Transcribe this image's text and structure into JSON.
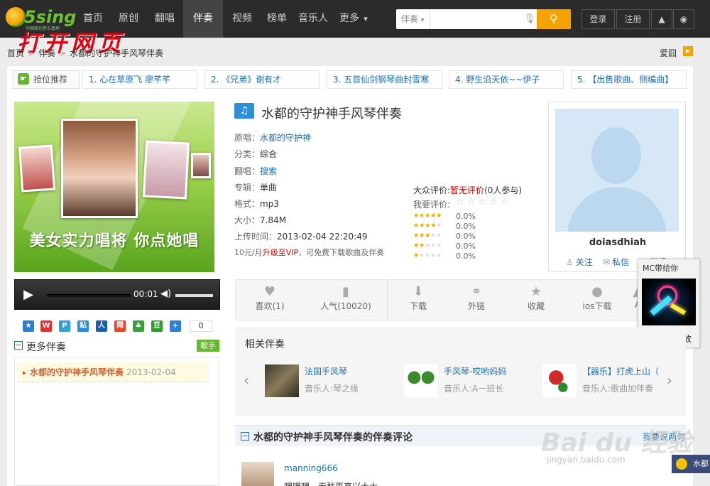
{
  "topnav": {
    "logo_text": "5sing",
    "logo_sub": "中国原创音乐基地",
    "items": [
      "首页",
      "原创",
      "翻唱",
      "伴奏",
      "视频",
      "榜单",
      "音乐人",
      "更多"
    ],
    "active": "伴奏",
    "more_arrow": "▾",
    "search_select": "伴奏",
    "search_select_arrow": "▾",
    "search_placeholder": "",
    "login": "登录",
    "register": "注册"
  },
  "watermark_red": "打开网页",
  "breadcrumb": {
    "home": "首页",
    "section": "伴奏",
    "current": "水都的守护神手风琴伴奏",
    "sep": ">"
  },
  "idol_label": "爱囧",
  "hot": {
    "label": "抢位推荐",
    "items": [
      "1. 心在草原飞 廖芊芊",
      "2. 《兄弟》谢有才",
      "3. 五首仙剑钢琴曲封雪寒",
      "4. 野生沿天依~~伊子",
      "5. 【出售歌曲、侧编曲】"
    ]
  },
  "banner": {
    "caption": "美女实力唱将 你点她唱"
  },
  "player": {
    "time": "00:01",
    "progress": 0.0
  },
  "share": {
    "count": "0"
  },
  "more": {
    "title": "更多伴奏",
    "tag": "歌手",
    "items": [
      {
        "name": "水都的守护神手风琴伴奏",
        "date": "2013-02-04"
      }
    ]
  },
  "song": {
    "title": "水都的守护神手风琴伴奏",
    "fields": [
      {
        "k": "原唱：",
        "v": "水都的守护神",
        "link": true
      },
      {
        "k": "分类：",
        "v": "综合",
        "link": false
      },
      {
        "k": "翻唱：",
        "v": "搜索",
        "link": true
      },
      {
        "k": "专辑：",
        "v": "单曲",
        "link": false
      },
      {
        "k": "格式：",
        "v": "mp3",
        "link": false
      },
      {
        "k": "大小：",
        "v": "7.84M",
        "link": false
      },
      {
        "k": "上传时间：",
        "v": "2013-02-04 22:20:49",
        "link": false
      }
    ],
    "vip_pre": "10元/月",
    "vip_link": "升级至VIP",
    "vip_post": "，可免费下载歌曲及伴奏"
  },
  "rating": {
    "public_label": "大众评价:",
    "public_value": "暂无评价",
    "public_count": "(0人参与)",
    "mine_label": "我要评价:",
    "stars": "☆☆☆☆☆",
    "dist": [
      {
        "stars": 5,
        "pct": "0.0%"
      },
      {
        "stars": 4,
        "pct": "0.0%"
      },
      {
        "stars": 3,
        "pct": "0.0%"
      },
      {
        "stars": 2,
        "pct": "0.0%"
      },
      {
        "stars": 1,
        "pct": "0.0%"
      }
    ]
  },
  "user": {
    "name": "doiasdhiah",
    "follow": "关注",
    "message": "私信",
    "report": "举报"
  },
  "actions": [
    {
      "label": "喜欢(1)",
      "icon": "heart-icon",
      "glyph": "♥"
    },
    {
      "label": "人气(10020)",
      "icon": "bar-chart-icon",
      "glyph": "▮"
    },
    {
      "label": "下载",
      "icon": "download-icon",
      "glyph": "⬇"
    },
    {
      "label": "外链",
      "icon": "link-icon",
      "glyph": "⚭"
    },
    {
      "label": "收藏",
      "icon": "star-icon",
      "glyph": "★"
    },
    {
      "label": "ios下载",
      "icon": "apple-icon",
      "glyph": "●"
    },
    {
      "label": "A",
      "icon": "android-icon",
      "glyph": "▲"
    }
  ],
  "mc": {
    "title": "MC带给你",
    "play": "马上播放"
  },
  "related": {
    "title": "相关伴奏",
    "items": [
      {
        "name": "法国手风琴",
        "artist": "音乐人:琴之缘"
      },
      {
        "name": "手风琴-哎哟妈妈",
        "artist": "音乐人:A一班长"
      },
      {
        "name": "【器乐】打虎上山（",
        "artist": "音乐人:歌曲加伴奏"
      }
    ]
  },
  "comments": {
    "title": "水都的守护神手风琴伴奏的伴奏评论",
    "more": "我要说两句",
    "items": [
      {
        "user": "manning666",
        "text": "嘿嘿嘿，无愁再高兴大大"
      }
    ]
  },
  "watermark_baidu": "Bai du 经验",
  "watermark_baidu_url": "jingyan.baidu.com",
  "mini_player": "水都"
}
